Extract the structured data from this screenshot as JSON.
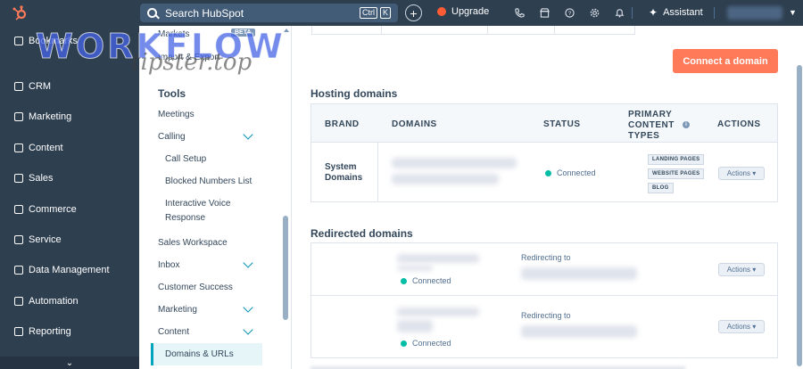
{
  "topbar": {
    "search_label": "Search HubSpot",
    "kbd_ctrl": "Ctrl",
    "kbd_k": "K",
    "plus": "+",
    "upgrade": "Upgrade",
    "assistant": "Assistant",
    "icons": [
      "phone-icon",
      "marketplace-icon",
      "help-icon",
      "settings-icon",
      "notifications-icon"
    ],
    "accent": "#ff5c35"
  },
  "leftnav": {
    "items": [
      {
        "label": "Bookmarks",
        "icon": "bookmark-icon"
      },
      {
        "label": "CRM",
        "icon": "crm-icon"
      },
      {
        "label": "Marketing",
        "icon": "marketing-icon"
      },
      {
        "label": "Content",
        "icon": "content-icon"
      },
      {
        "label": "Sales",
        "icon": "sales-icon"
      },
      {
        "label": "Commerce",
        "icon": "commerce-icon"
      },
      {
        "label": "Service",
        "icon": "service-icon"
      },
      {
        "label": "Data Management",
        "icon": "data-icon"
      },
      {
        "label": "Automation",
        "icon": "automation-icon"
      },
      {
        "label": "Reporting",
        "icon": "reporting-icon"
      }
    ],
    "collapse": "⌄"
  },
  "watermark": {
    "line1": "WORKFLOW",
    "line2": "tipster.top"
  },
  "settings": {
    "markets": "Markets",
    "beta": "BETA",
    "import_export": "Import & Export",
    "tools_heading": "Tools",
    "meetings": "Meetings",
    "calling": "Calling",
    "call_setup": "Call Setup",
    "blocked_numbers": "Blocked Numbers List",
    "ivr_line1": "Interactive Voice",
    "ivr_line2": "Response",
    "sales_workspace": "Sales Workspace",
    "inbox": "Inbox",
    "customer_success": "Customer Success",
    "marketing": "Marketing",
    "content": "Content",
    "domains_urls": "Domains & URLs"
  },
  "main": {
    "connect_button": "Connect a domain",
    "hosting_heading": "Hosting domains",
    "columns": {
      "brand": "BRAND",
      "domains": "DOMAINS",
      "status": "STATUS",
      "content_types_1": "PRIMARY",
      "content_types_2": "CONTENT",
      "content_types_3": "TYPES",
      "actions": "ACTIONS",
      "info": "i"
    },
    "hosting_row": {
      "brand_line1": "System",
      "brand_line2": "Domains",
      "status": "Connected",
      "tags": [
        "LANDING PAGES",
        "WEBSITE PAGES",
        "BLOG"
      ],
      "actions": "Actions ▾"
    },
    "redirected_heading": "Redirected domains",
    "redirected_rows": [
      {
        "status": "Connected",
        "redirect_label": "Redirecting to",
        "actions": "Actions ▾"
      },
      {
        "status": "Connected",
        "redirect_label": "Redirecting to",
        "actions": "Actions ▾"
      }
    ],
    "status_color": "#00bda5"
  }
}
